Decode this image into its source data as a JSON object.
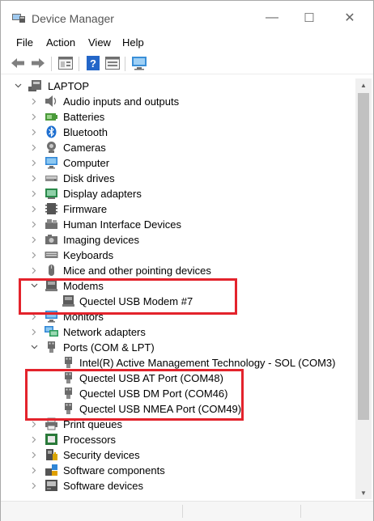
{
  "window": {
    "title": "Device Manager"
  },
  "controls": {
    "minimize": "—",
    "maximize": "☐",
    "close": "✕"
  },
  "menu": [
    "File",
    "Action",
    "View",
    "Help"
  ],
  "toolbar": [
    "back-icon",
    "forward-icon",
    "properties-icon",
    "help-icon",
    "view-icon",
    "scan-hardware-icon"
  ],
  "tree": {
    "root": "LAPTOP",
    "items": [
      {
        "label": "Audio inputs and outputs",
        "icon": "speaker-icon"
      },
      {
        "label": "Batteries",
        "icon": "battery-icon"
      },
      {
        "label": "Bluetooth",
        "icon": "bluetooth-icon"
      },
      {
        "label": "Cameras",
        "icon": "camera-icon"
      },
      {
        "label": "Computer",
        "icon": "monitor-icon"
      },
      {
        "label": "Disk drives",
        "icon": "disk-icon"
      },
      {
        "label": "Display adapters",
        "icon": "display-adapter-icon"
      },
      {
        "label": "Firmware",
        "icon": "firmware-icon"
      },
      {
        "label": "Human Interface Devices",
        "icon": "hid-icon"
      },
      {
        "label": "Imaging devices",
        "icon": "imaging-icon"
      },
      {
        "label": "Keyboards",
        "icon": "keyboard-icon"
      },
      {
        "label": "Mice and other pointing devices",
        "icon": "mouse-icon"
      },
      {
        "label": "Modems",
        "icon": "modem-icon",
        "expanded": true
      },
      {
        "label": "Quectel USB Modem #7",
        "icon": "modem-icon",
        "child": true
      },
      {
        "label": "Monitors",
        "icon": "monitor-icon"
      },
      {
        "label": "Network adapters",
        "icon": "network-icon"
      },
      {
        "label": "Ports (COM & LPT)",
        "icon": "port-icon",
        "expanded": true
      },
      {
        "label": "Intel(R) Active Management Technology - SOL (COM3)",
        "icon": "port-icon",
        "child": true
      },
      {
        "label": "Quectel USB AT Port (COM48)",
        "icon": "port-icon",
        "child": true
      },
      {
        "label": "Quectel USB DM Port (COM46)",
        "icon": "port-icon",
        "child": true
      },
      {
        "label": "Quectel USB NMEA Port (COM49)",
        "icon": "port-icon",
        "child": true
      },
      {
        "label": "Print queues",
        "icon": "printer-icon"
      },
      {
        "label": "Processors",
        "icon": "processor-icon"
      },
      {
        "label": "Security devices",
        "icon": "security-icon"
      },
      {
        "label": "Software components",
        "icon": "software-component-icon"
      },
      {
        "label": "Software devices",
        "icon": "software-device-icon"
      }
    ]
  },
  "colors": {
    "highlight": "#e3232c",
    "accent": "#1e78d7"
  }
}
